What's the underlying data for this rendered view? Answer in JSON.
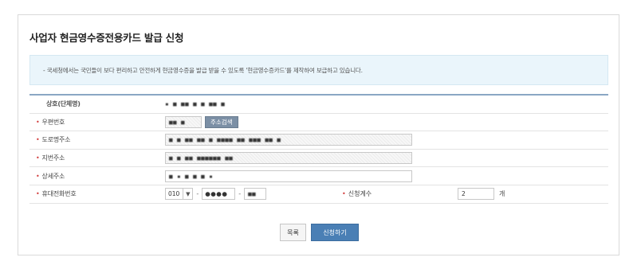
{
  "page": {
    "title": "사업자 현금영수증전용카드 발급 신청"
  },
  "notice": {
    "text": "- 국세청에서는 국민들이 보다 편리하고 안전하게 현금영수증을 발급 받을 수 있도록 '현금영수증카드'를 제작하여 보급하고 있습니다."
  },
  "form": {
    "business_name": {
      "label": "상호(단체명)",
      "value": "▪ ■ ■■ ■ ■ ■■ ■"
    },
    "postal_code": {
      "label": "우편번호",
      "value": "■■ ■",
      "search_button": "주소검색"
    },
    "road_address": {
      "label": "도로명주소",
      "value": "■ ■ ■■ ■■ ■ ■■■■ ■■ ■■■ ■■ ■"
    },
    "lot_address": {
      "label": "지번주소",
      "value": "■ ■ ■■ ■■■■■■ ■■"
    },
    "detail_address": {
      "label": "상세주소",
      "value": "■ ▪ ■ ■ ■ ▪"
    },
    "mobile": {
      "label": "휴대전화번호",
      "prefix": "010",
      "middle": "●●●●",
      "last": "■■",
      "separator": "-"
    },
    "request_count": {
      "label": "신청계수",
      "value": "2",
      "unit": "개"
    }
  },
  "buttons": {
    "list": "목록",
    "submit": "신청하기"
  },
  "icons": {
    "required": "required-bullet",
    "dropdown": "chevron-down-icon"
  },
  "colors": {
    "required": "#d23c3c",
    "submit_bg": "#4a7fb5",
    "address_btn_bg": "#7b8fa5",
    "notice_bg": "#eaf5fb",
    "form_top_border": "#8aa7c4"
  }
}
